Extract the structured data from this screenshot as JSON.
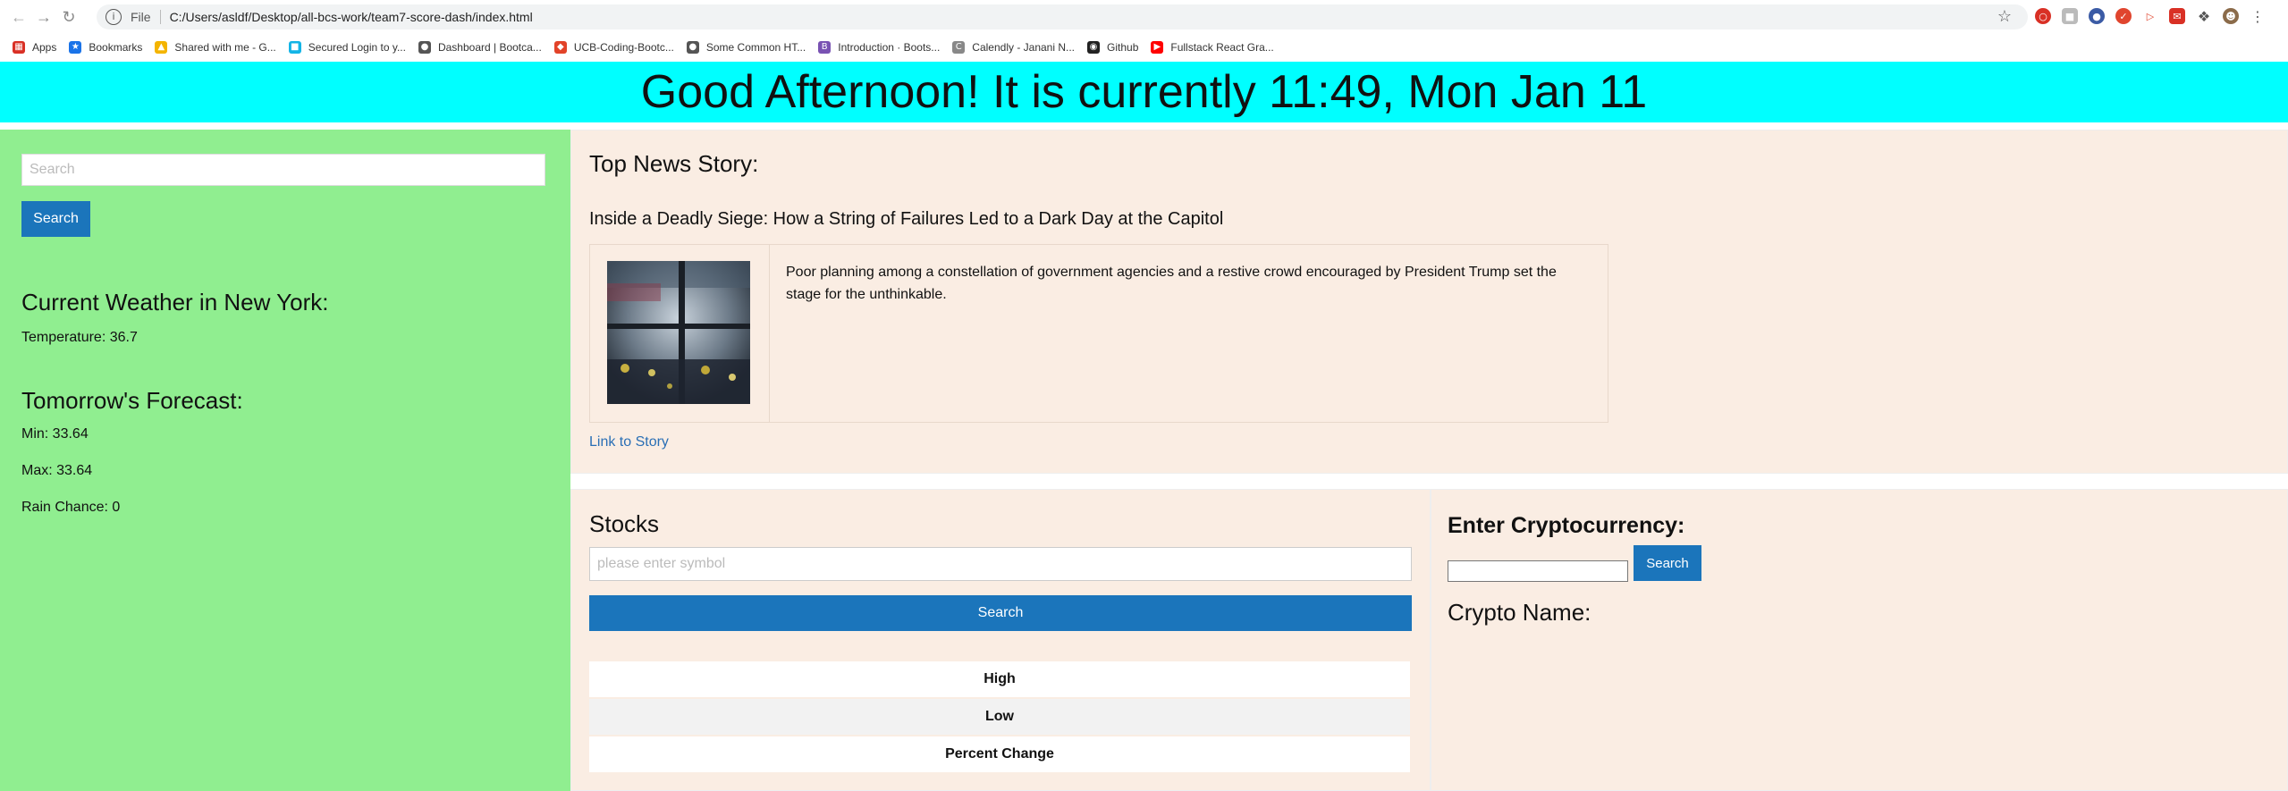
{
  "browser": {
    "url_scheme_label": "File",
    "url": "C:/Users/asldf/Desktop/all-bcs-work/team7-score-dash/index.html",
    "bookmarks": [
      {
        "label": "Apps",
        "icon": "apps-grid-icon",
        "color": "#d93025"
      },
      {
        "label": "Bookmarks",
        "icon": "star-icon",
        "color": "#1a73e8"
      },
      {
        "label": "Shared with me - G...",
        "icon": "drive-icon",
        "color": "#f4b400"
      },
      {
        "label": "Secured Login to y...",
        "icon": "login-icon",
        "color": "#13b4e6"
      },
      {
        "label": "Dashboard | Bootca...",
        "icon": "globe-icon",
        "color": "#555555"
      },
      {
        "label": "UCB-Coding-Bootc...",
        "icon": "gitlab-icon",
        "color": "#e24329"
      },
      {
        "label": "Some Common HT...",
        "icon": "globe-icon",
        "color": "#555555"
      },
      {
        "label": "Introduction · Boots...",
        "icon": "bootstrap-icon",
        "color": "#7952b3"
      },
      {
        "label": "Calendly - Janani N...",
        "icon": "calendly-icon",
        "color": "#888888"
      },
      {
        "label": "Github",
        "icon": "github-icon",
        "color": "#222222"
      },
      {
        "label": "Fullstack React Gra...",
        "icon": "youtube-icon",
        "color": "#ff0000"
      }
    ]
  },
  "banner": {
    "text": "Good Afternoon! It is currently 11:49, Mon Jan 11"
  },
  "sidebar": {
    "search_placeholder": "Search",
    "search_button": "Search",
    "weather_title": "Current Weather in New York:",
    "temperature": "Temperature: 36.7",
    "forecast_title": "Tomorrow's Forecast:",
    "min": "Min: 33.64",
    "max": "Max: 33.64",
    "rain": "Rain Chance: 0"
  },
  "news": {
    "heading": "Top News Story:",
    "title": "Inside a Deadly Siege: How a String of Failures Led to a Dark Day at the Capitol",
    "summary": "Poor planning among a constellation of government agencies and a restive crowd encouraged by President Trump set the stage for the unthinkable.",
    "link": "Link to Story"
  },
  "stocks": {
    "title": "Stocks",
    "input_placeholder": "please enter symbol",
    "search_button": "Search",
    "rows": [
      "High",
      "Low",
      "Percent Change"
    ]
  },
  "crypto": {
    "title": "Enter Cryptocurrency:",
    "search_button": "Search",
    "name_label": "Crypto Name:"
  },
  "colors": {
    "banner_bg": "#00ffff",
    "sidebar_bg": "#90ee90",
    "panel_bg": "#faede3",
    "button_blue": "#1b75bb",
    "link_blue": "#2a6fb5"
  }
}
